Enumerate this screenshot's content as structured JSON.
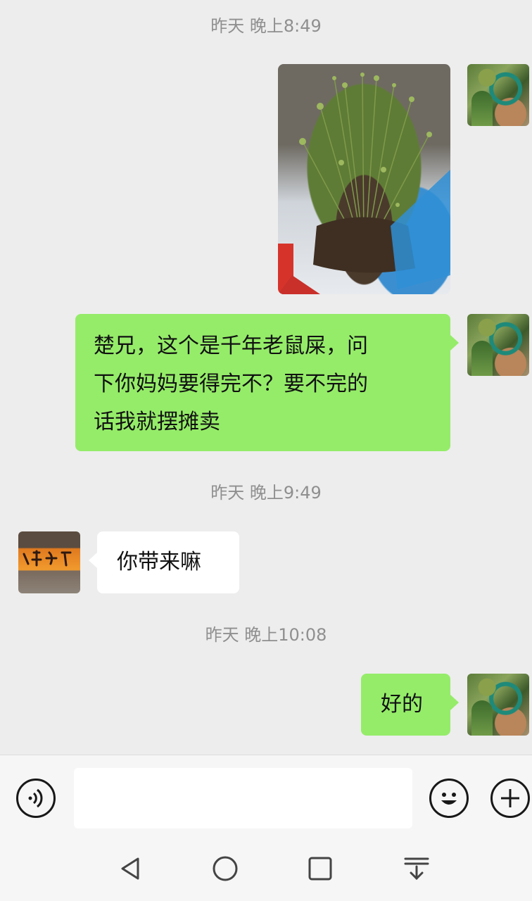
{
  "messages": [
    {
      "type": "timestamp",
      "text": "昨天 晚上8:49"
    },
    {
      "type": "image",
      "sender": "me"
    },
    {
      "type": "text",
      "sender": "me",
      "lines": [
        "楚兄，这个是千年老鼠屎，问",
        "下你妈妈要得完不？要不完的",
        "话我就摆摊卖"
      ]
    },
    {
      "type": "timestamp",
      "text": "昨天 晚上9:49"
    },
    {
      "type": "text",
      "sender": "other",
      "text": "你带来嘛"
    },
    {
      "type": "timestamp",
      "text": "昨天 晚上10:08"
    },
    {
      "type": "text",
      "sender": "me",
      "text": "好的"
    }
  ],
  "input_bar": {
    "text_value": "",
    "icons": [
      "voice-icon",
      "emoji-icon",
      "plus-icon"
    ]
  },
  "nav_bar": {
    "icons": [
      "back-triangle-icon",
      "home-circle-icon",
      "recents-square-icon",
      "notification-pull-icon"
    ]
  },
  "colors": {
    "background": "#ededed",
    "my_bubble": "#95ec69",
    "other_bubble": "#ffffff",
    "timestamp": "#8f8f8f"
  }
}
